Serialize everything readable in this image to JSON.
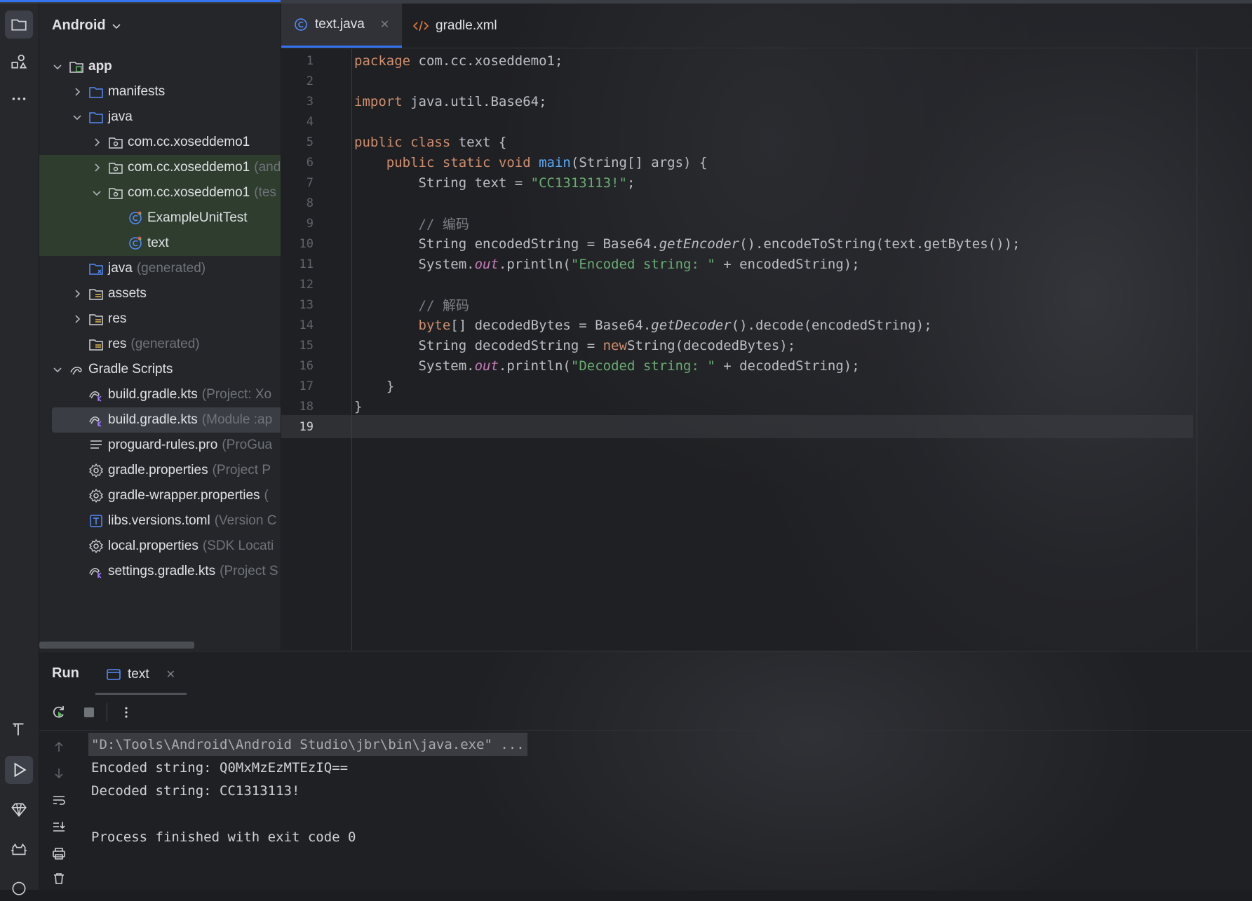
{
  "project": {
    "view_label": "Android",
    "tree": [
      {
        "label": "app",
        "hint": "",
        "level": 0,
        "expanded": true,
        "icon": "module-icon",
        "bold": true
      },
      {
        "label": "manifests",
        "hint": "",
        "level": 1,
        "expanded": false,
        "icon": "folder-icon"
      },
      {
        "label": "java",
        "hint": "",
        "level": 1,
        "expanded": true,
        "icon": "folder-icon"
      },
      {
        "label": "com.cc.xoseddemo1",
        "hint": "",
        "level": 2,
        "expanded": false,
        "icon": "package-icon"
      },
      {
        "label": "com.cc.xoseddemo1",
        "hint": "(and",
        "level": 2,
        "expanded": false,
        "icon": "package-icon",
        "highlight": true
      },
      {
        "label": "com.cc.xoseddemo1",
        "hint": "(tes",
        "level": 2,
        "expanded": true,
        "icon": "package-icon",
        "highlight": true
      },
      {
        "label": "ExampleUnitTest",
        "hint": "",
        "level": 3,
        "icon": "test-class-icon",
        "highlight": true
      },
      {
        "label": "text",
        "hint": "",
        "level": 3,
        "icon": "test-class-icon",
        "highlight": true
      },
      {
        "label": "java",
        "hint": "(generated)",
        "level": 1,
        "icon": "generated-folder-icon"
      },
      {
        "label": "assets",
        "hint": "",
        "level": 1,
        "expanded": false,
        "icon": "resource-folder-icon"
      },
      {
        "label": "res",
        "hint": "",
        "level": 1,
        "expanded": false,
        "icon": "resource-folder-icon"
      },
      {
        "label": "res",
        "hint": "(generated)",
        "level": 1,
        "icon": "resource-folder-icon"
      },
      {
        "label": "Gradle Scripts",
        "hint": "",
        "level": 0,
        "expanded": true,
        "icon": "gradle-icon"
      },
      {
        "label": "build.gradle.kts",
        "hint": "(Project: Xo",
        "level": 1,
        "icon": "gradle-kts-icon"
      },
      {
        "label": "build.gradle.kts",
        "hint": "(Module :ap",
        "level": 1,
        "icon": "gradle-kts-icon",
        "selected": true
      },
      {
        "label": "proguard-rules.pro",
        "hint": "(ProGua",
        "level": 1,
        "icon": "text-file-icon"
      },
      {
        "label": "gradle.properties",
        "hint": "(Project P",
        "level": 1,
        "icon": "settings-icon"
      },
      {
        "label": "gradle-wrapper.properties",
        "hint": "(",
        "level": 1,
        "icon": "settings-icon"
      },
      {
        "label": "libs.versions.toml",
        "hint": "(Version C",
        "level": 1,
        "icon": "toml-icon"
      },
      {
        "label": "local.properties",
        "hint": "(SDK Locati",
        "level": 1,
        "icon": "settings-icon"
      },
      {
        "label": "settings.gradle.kts",
        "hint": "(Project S",
        "level": 1,
        "icon": "gradle-kts-icon"
      }
    ]
  },
  "editor": {
    "tabs": [
      {
        "label": "text.java",
        "active": true,
        "icon": "java-class-icon",
        "closable": true
      },
      {
        "label": "gradle.xml",
        "active": false,
        "icon": "xml-icon",
        "closable": false
      }
    ],
    "current_line": 19,
    "lines": [
      [
        [
          "kw",
          "package"
        ],
        [
          "",
          "com.cc.xoseddemo1;"
        ]
      ],
      [],
      [
        [
          "kw",
          "import"
        ],
        [
          "",
          "java.util.Base64;"
        ]
      ],
      [],
      [
        [
          "kw",
          "public class"
        ],
        [
          "",
          "text {"
        ]
      ],
      [
        [
          "",
          "    "
        ],
        [
          "kw",
          "public static void"
        ],
        [
          "fn",
          "main"
        ],
        [
          "",
          "(String[] args) {"
        ]
      ],
      [
        [
          "",
          "        String text = "
        ],
        [
          "str",
          "\"CC1313113!\""
        ],
        [
          "",
          ";"
        ]
      ],
      [],
      [
        [
          "",
          "        "
        ],
        [
          "cmt",
          "// 编码"
        ]
      ],
      [
        [
          "",
          "        String encodedString = Base64."
        ],
        [
          "it",
          "getEncoder"
        ],
        [
          "",
          "().encodeToString(text.getBytes());"
        ]
      ],
      [
        [
          "",
          "        System."
        ],
        [
          "fld",
          "out"
        ],
        [
          "",
          ".println("
        ],
        [
          "str",
          "\"Encoded string: \""
        ],
        [
          "",
          " + encodedString);"
        ]
      ],
      [],
      [
        [
          "",
          "        "
        ],
        [
          "cmt",
          "// 解码"
        ]
      ],
      [
        [
          "",
          "        "
        ],
        [
          "kw",
          "byte"
        ],
        [
          "",
          "[] decodedBytes = Base64."
        ],
        [
          "it",
          "getDecoder"
        ],
        [
          "",
          "().decode(encodedString);"
        ]
      ],
      [
        [
          "",
          "        String decodedString = "
        ],
        [
          "kw",
          "new"
        ],
        [
          "",
          ""
        ],
        [
          "",
          "String(decodedBytes);"
        ]
      ],
      [
        [
          "",
          "        System."
        ],
        [
          "fld",
          "out"
        ],
        [
          "",
          ".println("
        ],
        [
          "str",
          "\"Decoded string: \""
        ],
        [
          "",
          " + decodedString);"
        ]
      ],
      [
        [
          "",
          "    }"
        ]
      ],
      [
        [
          "",
          "}"
        ]
      ],
      []
    ]
  },
  "run": {
    "title": "Run",
    "tab_label": "text",
    "output": [
      "\"D:\\Tools\\Android\\Android Studio\\jbr\\bin\\java.exe\" ...",
      "Encoded string: Q0MxMzEzMTEzIQ==",
      "Decoded string: CC1313113!",
      "",
      "Process finished with exit code 0"
    ]
  },
  "colors": {
    "accent": "#3574f0",
    "keyword": "#cf8e6d",
    "string": "#6aab73",
    "function": "#56a8f5",
    "field": "#c77dbb",
    "comment": "#7a7e85"
  }
}
